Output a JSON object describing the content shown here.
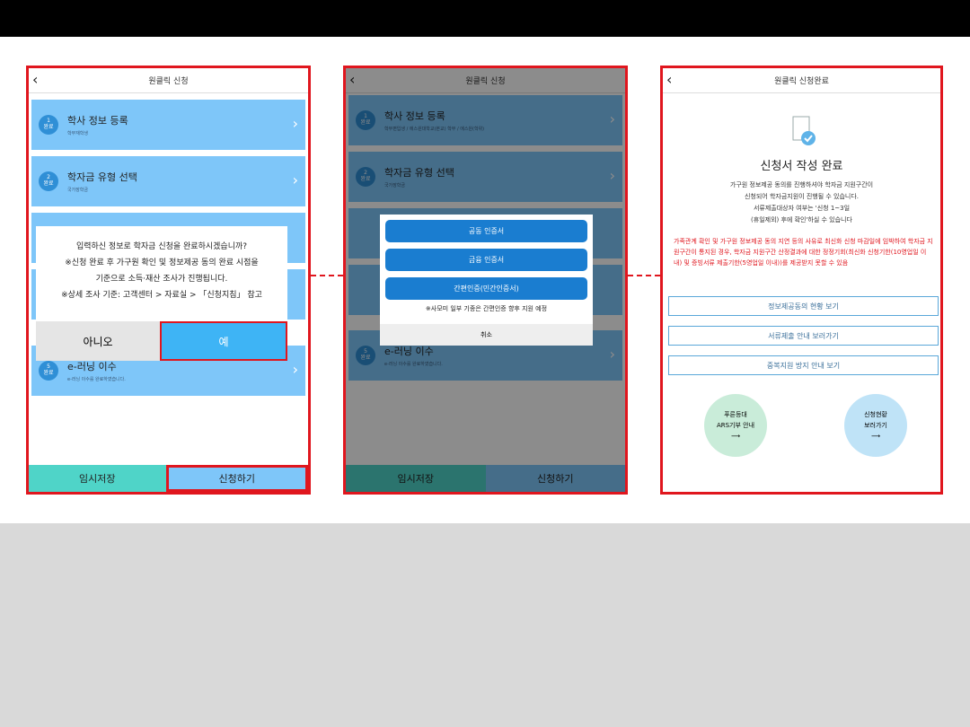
{
  "p1": {
    "title": "원클릭 신청",
    "items": [
      {
        "t": "학사 정보 등록",
        "s": "학부재학생"
      },
      {
        "t": "학자금 유형 선택",
        "s": "국가장학금"
      },
      {
        "t": "e-러닝 이수",
        "s": "e-러닝 이수를 완료하였습니다."
      }
    ],
    "done": "완료",
    "msg": [
      "입력하신 정보로 학자금 신청을 완료하시겠습니까?",
      "※신청 완료 후 가구원 확인 및 정보제공 동의 완료 시점을",
      "기준으로 소득·재산 조사가 진행됩니다.",
      "※상세 조사 기준: 고객센터 > 자료실 > 「신청지침」 참고"
    ],
    "no": "아니오",
    "yes": "예",
    "save": "임시저장",
    "apply": "신청하기"
  },
  "p2": {
    "title": "원클릭 신청",
    "items": [
      {
        "t": "학사 정보 등록",
        "s": "학부편입생 / 에스원대학교(본교) 학부 / 에스원(학위)"
      },
      {
        "t": "학자금 유형 선택",
        "s": "국가장학금"
      },
      {
        "t": "e-러닝 이수",
        "s": "e-러닝 이수를 완료하였습니다."
      }
    ],
    "btns": [
      "공동 인증서",
      "금융 인증서",
      "간편인증(민간인증서)"
    ],
    "note": "※사모미 일부 기종은 간편인증 향후 지원 예정",
    "cancel": "취소",
    "save": "임시저장",
    "apply": "신청하기"
  },
  "p3": {
    "title": "원클릭 신청완료",
    "head": "신청서 작성 완료",
    "l1": "가구원 정보제공 동의를 진행하셔야 학자금 지원구간이",
    "l2": "신청되어 학자금지원이 진행될 수 있습니다.",
    "l3": "서류제출대상자 여부는 '신청 1~3일",
    "l4": "(휴일제외) 후에 확인'하실 수 있습니다",
    "warn": "가족관계 확인 및 가구원 정보제공 동의 지연 등의 사유로 최신화 신청 마감일에 임박하여 학자금 지원구간이 통지된 경우, 학자금 지원구간 산정결과에 대한 정정기회(최신화 신청기한(10영업일 이내) 및 증빙서류 제출기한(5영업일 이내))를 제공받지 못할 수 있음",
    "links": [
      "정보제공동의 현황 보기",
      "서류제출 안내 보러가기",
      "중복지원 방지 안내 보기"
    ],
    "c1": [
      "푸른등대",
      "ARS기부 안내"
    ],
    "c2": [
      "신청현황",
      "보러가기"
    ]
  }
}
